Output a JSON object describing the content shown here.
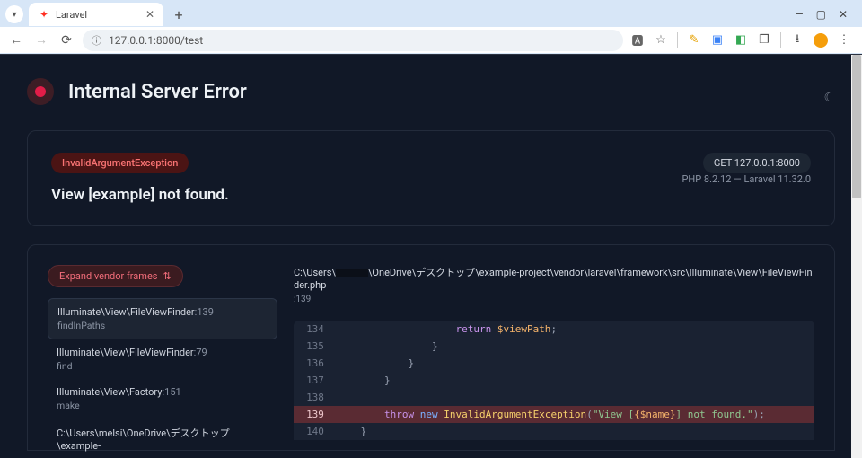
{
  "browser": {
    "tab_title": "Laravel",
    "url": "127.0.0.1:8000/test"
  },
  "page": {
    "title": "Internal Server Error",
    "exception_class": "InvalidArgumentException",
    "request_badge": "GET 127.0.0.1:8000",
    "error_message": "View [example] not found.",
    "env_line": "PHP 8.2.12 — Laravel 11.32.0"
  },
  "trace": {
    "expand_label": "Expand vendor frames",
    "file_prefix": "C:\\Users\\",
    "file_suffix": "\\OneDrive\\デスクトップ\\example-project\\vendor\\laravel\\framework\\src\\Illuminate\\View\\FileViewFinder.php",
    "highlight_line": ":139",
    "frames": [
      {
        "loc": "Illuminate\\View\\FileViewFinder",
        "line": ":139",
        "fn": "findInPaths"
      },
      {
        "loc": "Illuminate\\View\\FileViewFinder",
        "line": ":79",
        "fn": "find"
      },
      {
        "loc": "Illuminate\\View\\Factory",
        "line": ":151",
        "fn": "make"
      },
      {
        "loc": "C:\\Users\\melsi\\OneDrive\\デスクトップ\\example-",
        "line": "",
        "fn": ""
      }
    ],
    "code": {
      "134": {
        "pre": "                    ",
        "tokens": [
          [
            "return",
            "k-return"
          ],
          [
            " ",
            ""
          ],
          [
            "$viewPath",
            "k-var"
          ],
          [
            ";",
            ""
          ]
        ]
      },
      "135": {
        "pre": "                ",
        "tokens": [
          [
            "}",
            ""
          ]
        ]
      },
      "136": {
        "pre": "            ",
        "tokens": [
          [
            "}",
            ""
          ]
        ]
      },
      "137": {
        "pre": "        ",
        "tokens": [
          [
            "}",
            ""
          ]
        ]
      },
      "138": {
        "pre": "",
        "tokens": []
      },
      "139": {
        "pre": "        ",
        "tokens": [
          [
            "throw",
            "k-throw"
          ],
          [
            " ",
            ""
          ],
          [
            "new",
            "k-new"
          ],
          [
            " ",
            ""
          ],
          [
            "InvalidArgumentException",
            "k-class"
          ],
          [
            "(",
            ""
          ],
          [
            "\"View [",
            "k-str"
          ],
          [
            "{$name}",
            "k-interp"
          ],
          [
            "] not found.\"",
            "k-str"
          ],
          [
            ");",
            ""
          ]
        ]
      },
      "140": {
        "pre": "    ",
        "tokens": [
          [
            "}",
            ""
          ]
        ]
      }
    }
  }
}
